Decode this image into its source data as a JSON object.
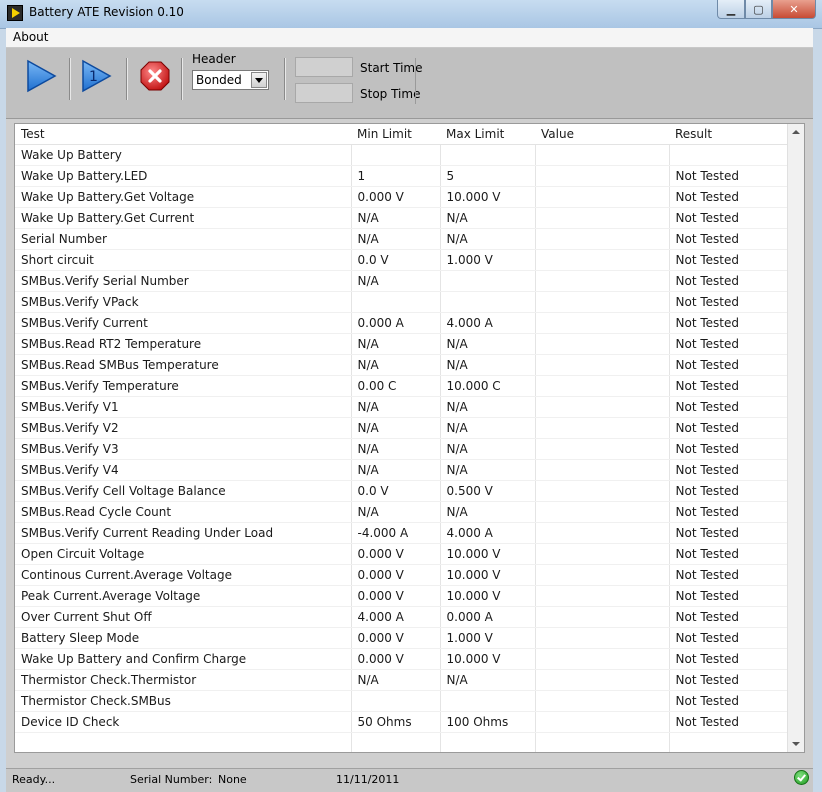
{
  "window": {
    "title": "Battery ATE Revision 0.10",
    "controls": {
      "minimize_icon": "minimize-icon",
      "maximize_icon": "maximize-icon",
      "close_icon": "close-icon",
      "close_label": "✕"
    }
  },
  "menu": {
    "about": "About"
  },
  "toolbar": {
    "run_icon": "play-icon",
    "run_once_label": "1",
    "stop_icon": "stop-icon",
    "header_label": "Header",
    "header_value": "Bonded",
    "start_time_label": "Start Time",
    "start_time_value": "",
    "stop_time_label": "Stop Time",
    "stop_time_value": ""
  },
  "table": {
    "columns": [
      "Test",
      "Min Limit",
      "Max Limit",
      "Value",
      "Result"
    ],
    "rows": [
      [
        "Wake Up Battery",
        "",
        "",
        "",
        ""
      ],
      [
        "Wake Up Battery.LED",
        "1",
        "5",
        "",
        "Not Tested"
      ],
      [
        "Wake Up Battery.Get Voltage",
        "0.000 V",
        "10.000 V",
        "",
        "Not Tested"
      ],
      [
        "Wake Up Battery.Get Current",
        "N/A",
        "N/A",
        "",
        "Not Tested"
      ],
      [
        "Serial Number",
        "N/A",
        "N/A",
        "",
        "Not Tested"
      ],
      [
        "Short circuit",
        "0.0 V",
        "1.000 V",
        "",
        "Not Tested"
      ],
      [
        "SMBus.Verify Serial Number",
        "N/A",
        "",
        "",
        "Not Tested"
      ],
      [
        "SMBus.Verify VPack",
        "",
        "",
        "",
        "Not Tested"
      ],
      [
        "SMBus.Verify Current",
        "0.000 A",
        "4.000 A",
        "",
        "Not Tested"
      ],
      [
        "SMBus.Read RT2 Temperature",
        "N/A",
        "N/A",
        "",
        "Not Tested"
      ],
      [
        "SMBus.Read SMBus Temperature",
        "N/A",
        "N/A",
        "",
        "Not Tested"
      ],
      [
        "SMBus.Verify Temperature",
        "0.00 C",
        "10.000 C",
        "",
        "Not Tested"
      ],
      [
        "SMBus.Verify V1",
        "N/A",
        "N/A",
        "",
        "Not Tested"
      ],
      [
        "SMBus.Verify V2",
        "N/A",
        "N/A",
        "",
        "Not Tested"
      ],
      [
        "SMBus.Verify V3",
        "N/A",
        "N/A",
        "",
        "Not Tested"
      ],
      [
        "SMBus.Verify V4",
        "N/A",
        "N/A",
        "",
        "Not Tested"
      ],
      [
        "SMBus.Verify Cell Voltage Balance",
        "0.0 V",
        "0.500 V",
        "",
        "Not Tested"
      ],
      [
        "SMBus.Read Cycle Count",
        "N/A",
        "N/A",
        "",
        "Not Tested"
      ],
      [
        "SMBus.Verify Current Reading Under Load",
        "-4.000 A",
        "4.000 A",
        "",
        "Not Tested"
      ],
      [
        "Open Circuit Voltage",
        "0.000 V",
        "10.000 V",
        "",
        "Not Tested"
      ],
      [
        "Continous Current.Average Voltage",
        "0.000 V",
        "10.000 V",
        "",
        "Not Tested"
      ],
      [
        "Peak Current.Average Voltage",
        "0.000 V",
        "10.000 V",
        "",
        "Not Tested"
      ],
      [
        "Over Current Shut Off",
        "4.000 A",
        "0.000 A",
        "",
        "Not Tested"
      ],
      [
        "Battery Sleep Mode",
        "0.000 V",
        "1.000 V",
        "",
        "Not Tested"
      ],
      [
        "Wake Up Battery and Confirm Charge",
        "0.000 V",
        "10.000 V",
        "",
        "Not Tested"
      ],
      [
        "Thermistor Check.Thermistor",
        "N/A",
        "N/A",
        "",
        "Not Tested"
      ],
      [
        "Thermistor Check.SMBus",
        "",
        "",
        "",
        "Not Tested"
      ],
      [
        "Device ID Check",
        "50 Ohms",
        "100 Ohms",
        "",
        "Not Tested"
      ]
    ]
  },
  "status": {
    "state": "Ready...",
    "serial_label": "Serial Number:",
    "serial_value": "None",
    "date": "11/11/2011",
    "ok_icon": "check-circle-icon",
    "ok_color": "#2fa52f"
  }
}
